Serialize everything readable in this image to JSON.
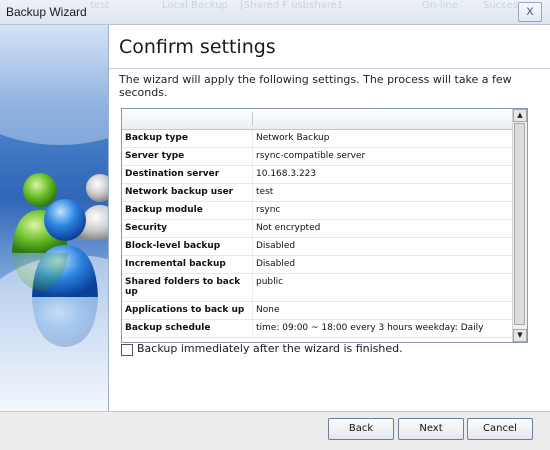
{
  "window": {
    "title": "Backup Wizard",
    "close_glyph": "x"
  },
  "background_app": {
    "columns": [
      "test",
      "Local Backup",
      "[Shared F usbshare1",
      "On-line",
      "Success"
    ]
  },
  "page": {
    "heading": "Confirm settings",
    "description": "The wizard will apply the following settings. The process will take a few seconds."
  },
  "settings": [
    {
      "label": "Backup type",
      "value": "Network Backup"
    },
    {
      "label": "Server type",
      "value": "rsync-compatible server"
    },
    {
      "label": "Destination server",
      "value": "10.168.3.223"
    },
    {
      "label": "Network backup user",
      "value": "test"
    },
    {
      "label": "Backup module",
      "value": "rsync"
    },
    {
      "label": "Security",
      "value": "Not encrypted"
    },
    {
      "label": "Block-level backup",
      "value": "Disabled"
    },
    {
      "label": "Incremental backup",
      "value": "Disabled"
    },
    {
      "label": "Shared folders to back up",
      "value": "public"
    },
    {
      "label": "Applications to back up",
      "value": "None"
    },
    {
      "label": "Backup schedule",
      "value": "time: 09:00 ~ 18:00 every 3 hours weekday: Daily"
    }
  ],
  "checkbox": {
    "label": "Backup immediately after the wizard is finished.",
    "checked": false
  },
  "buttons": {
    "back": "Back",
    "next": "Next",
    "cancel": "Cancel"
  },
  "icons": {
    "scroll_up": "scroll-up-icon",
    "scroll_down": "scroll-down-icon",
    "users": "users-icon"
  }
}
